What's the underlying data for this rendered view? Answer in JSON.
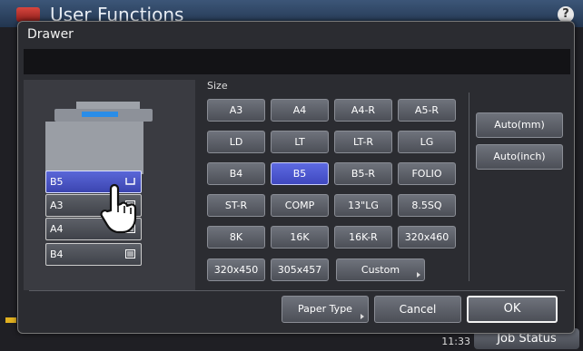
{
  "background": {
    "app_title": "User Functions",
    "help_label": "?",
    "time": "11:33",
    "job_status_label": "Job Status"
  },
  "dialog": {
    "title": "Drawer",
    "message": ""
  },
  "drawers": [
    {
      "label": "B5",
      "selected": true
    },
    {
      "label": "A3",
      "selected": false
    },
    {
      "label": "A4",
      "selected": false
    },
    {
      "label": "B4",
      "selected": false
    }
  ],
  "size": {
    "label": "Size",
    "rows": [
      [
        "A3",
        "A4",
        "A4-R",
        "A5-R"
      ],
      [
        "LD",
        "LT",
        "LT-R",
        "LG"
      ],
      [
        "B4",
        "B5",
        "B5-R",
        "FOLIO"
      ],
      [
        "ST-R",
        "COMP",
        "13\"LG",
        "8.5SQ"
      ],
      [
        "8K",
        "16K",
        "16K-R",
        "320x460"
      ],
      [
        "320x450",
        "305x457"
      ]
    ],
    "selected": "B5",
    "custom_label": "Custom"
  },
  "auto": {
    "mm_label": "Auto(mm)",
    "inch_label": "Auto(inch)"
  },
  "footer": {
    "paper_type_label": "Paper Type",
    "cancel_label": "Cancel",
    "ok_label": "OK"
  },
  "colors": {
    "selected": "#4a55cc",
    "button": "#5e626a",
    "dialog_bg": "#2b2c31"
  }
}
